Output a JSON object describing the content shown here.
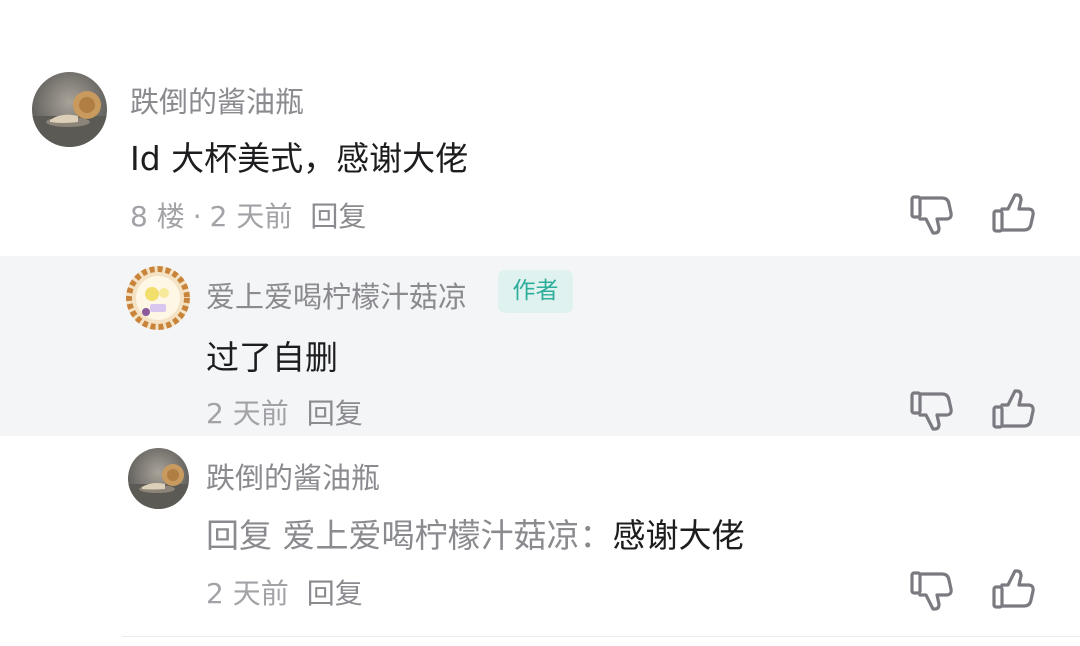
{
  "comments": [
    {
      "author": "跌倒的酱油瓶",
      "body": "Id 大杯美式，感谢大佬",
      "floor": "8 楼",
      "separator": "·",
      "time": "2 天前",
      "reply_label": "回复"
    },
    {
      "author": "爱上爱喝柠檬汁菇凉",
      "badge": "作者",
      "body": "过了自删",
      "time": "2 天前",
      "reply_label": "回复"
    },
    {
      "author": "跌倒的酱油瓶",
      "reply_prefix": "回复",
      "reply_to": "爱上爱喝柠檬汁菇凉：",
      "body": "感谢大佬",
      "time": "2 天前",
      "reply_label": "回复"
    }
  ],
  "icons": {
    "dislike": "thumbs-down-icon",
    "like": "thumbs-up-icon"
  },
  "colors": {
    "badge_text": "#2dae9b",
    "badge_bg": "#e0f2ef",
    "highlight_bg": "#f4f5f7"
  }
}
